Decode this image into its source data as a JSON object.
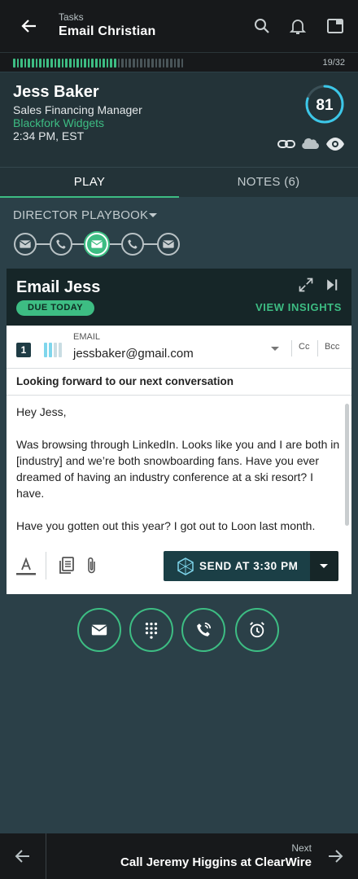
{
  "header": {
    "crumb": "Tasks",
    "title": "Email Christian"
  },
  "progress": {
    "done": 28,
    "total": 46,
    "count": "19/32"
  },
  "contact": {
    "name": "Jess Baker",
    "role": "Sales Financing Manager",
    "company": "Blackfork Widgets",
    "time": "2:34 PM, EST",
    "score": "81",
    "score_fraction": 0.8
  },
  "tabs": {
    "play": "PLAY",
    "notes": "NOTES (6)"
  },
  "playbook": {
    "name": "DIRECTOR PLAYBOOK",
    "steps": [
      "email-icon",
      "phone-icon",
      "email-icon",
      "phone-icon",
      "email-icon"
    ],
    "current_step": 3
  },
  "task": {
    "title": "Email Jess",
    "due": "DUE TODAY",
    "insights": "VIEW INSIGHTS"
  },
  "email": {
    "step": "1",
    "label": "EMAIL",
    "to": "jessbaker@gmail.com",
    "cc": "Cc",
    "bcc": "Bcc",
    "subject": "Looking forward to our next conversation",
    "body": [
      "Hey Jess,",
      "Was browsing through LinkedIn. Looks like you and I are both in [industry] and we’re both snowboarding fans. Have you ever dreamed of having an industry conference at a ski resort? I have.",
      "Have you gotten out this year? I got out to Loon last month."
    ],
    "send_label": "SEND AT 3:30 PM"
  },
  "actions": [
    "email-icon",
    "dialpad-icon",
    "callback-icon",
    "alarm-icon"
  ],
  "footer": {
    "next_label": "Next",
    "next_title": "Call Jeremy Higgins at ClearWire"
  },
  "colors": {
    "accent": "#3dbd83",
    "dark": "#17191b",
    "panel": "#233338",
    "background": "#2b4048"
  }
}
